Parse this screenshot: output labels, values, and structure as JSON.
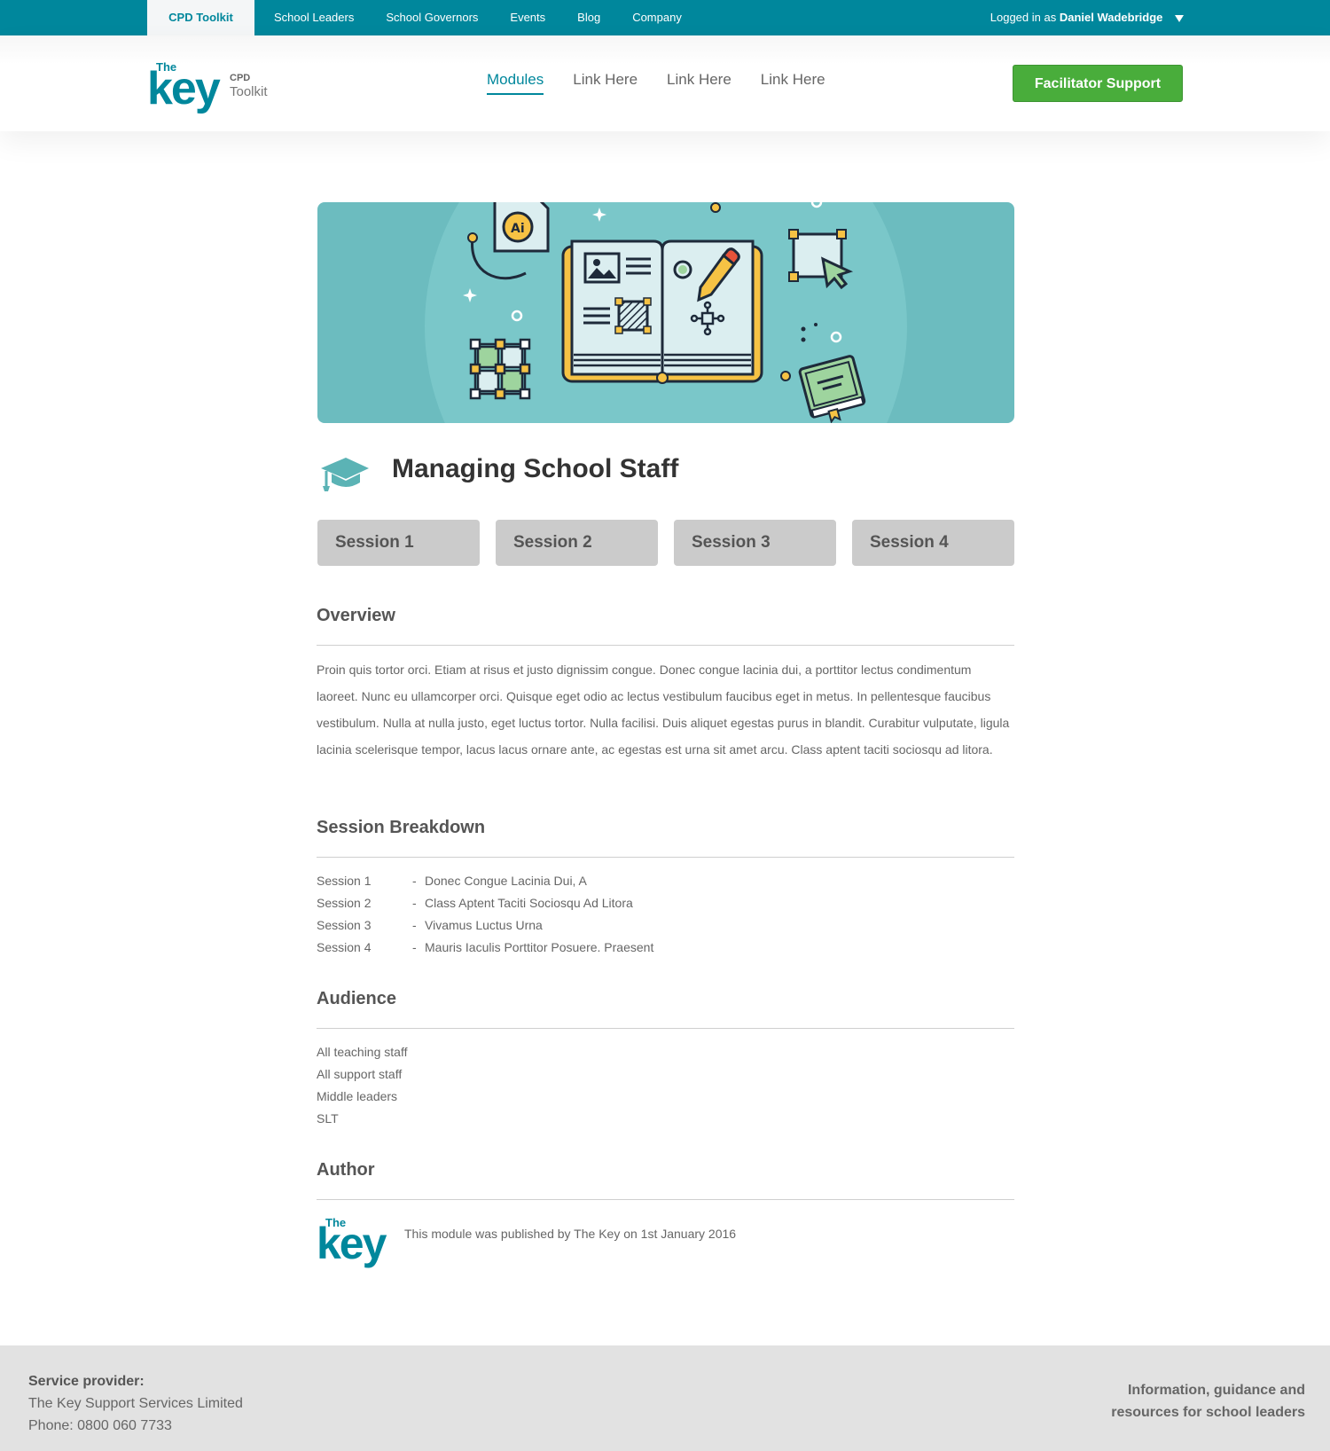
{
  "topbar": {
    "items": [
      "CPD Toolkit",
      "School Leaders",
      "School Governors",
      "Events",
      "Blog",
      "Company"
    ],
    "account_prefix": "Logged in as",
    "account_name": "Daniel Wadebridge"
  },
  "header": {
    "logo": {
      "the": "The",
      "key": "key",
      "cpd": "CPD",
      "toolkit": "Toolkit"
    },
    "nav": [
      "Modules",
      "Link Here",
      "Link Here",
      "Link Here"
    ],
    "support_button": "Facilitator Support"
  },
  "page": {
    "title": "Managing School Staff",
    "sessions": [
      "Session 1",
      "Session 2",
      "Session 3",
      "Session 4"
    ]
  },
  "overview": {
    "heading": "Overview",
    "text": "Proin quis tortor orci. Etiam at risus et justo dignissim congue. Donec congue lacinia dui, a porttitor lectus condimentum laoreet. Nunc eu ullamcorper orci. Quisque eget odio ac lectus vestibulum faucibus eget in metus. In pellentesque faucibus vestibulum. Nulla at nulla justo, eget luctus tortor. Nulla facilisi. Duis aliquet egestas purus in blandit. Curabitur vulputate, ligula lacinia scelerisque tempor, lacus lacus ornare ante, ac egestas est urna sit amet arcu. Class aptent taciti sociosqu ad litora."
  },
  "breakdown": {
    "heading": "Session Breakdown",
    "rows": [
      {
        "label": "Session 1",
        "text": "Donec Congue Lacinia Dui, A"
      },
      {
        "label": "Session 2",
        "text": "Class Aptent Taciti Sociosqu Ad Litora"
      },
      {
        "label": "Session 3",
        "text": "Vivamus Luctus Urna"
      },
      {
        "label": "Session 4",
        "text": "Mauris Iaculis Porttitor Posuere. Praesent"
      }
    ]
  },
  "audience": {
    "heading": "Audience",
    "items": [
      "All teaching staff",
      "All support staff",
      "Middle leaders",
      "SLT"
    ]
  },
  "author": {
    "heading": "Author",
    "logo_the": "The",
    "logo_key": "key",
    "text": "This module was published by The Key on 1st January 2016"
  },
  "footer": {
    "provider_label": "Service provider:",
    "provider_name": "The Key Support Services Limited",
    "phone": "Phone: 0800 060 7733",
    "tagline_1": "Information, guidance and",
    "tagline_2": "resources for school leaders"
  },
  "colors": {
    "brand": "#00879c",
    "button_green": "#49ad3b",
    "hero_bg": "#6cbcbf",
    "footer_bg": "#e2e2e2"
  },
  "icons": [
    "caret-down-icon",
    "graduation-cap-icon",
    "book-illustration",
    "ai-file-icon",
    "pencil-icon",
    "cursor-icon"
  ]
}
